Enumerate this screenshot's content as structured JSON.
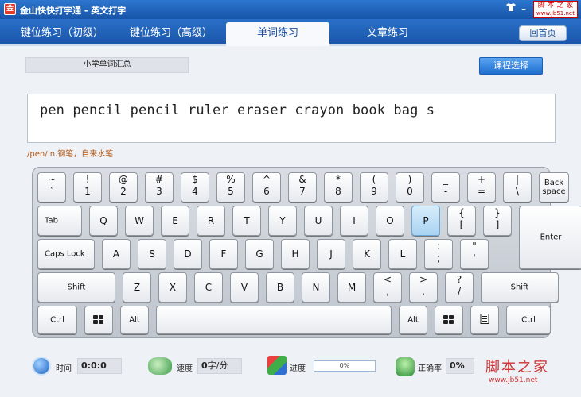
{
  "window": {
    "app_icon_text": "金",
    "title": "金山快快打字通 - 英文打字",
    "brand_top": "脚 本 之 家",
    "brand_bottom": "www.Jb51.net"
  },
  "tabs": [
    {
      "label": "键位练习（初级）",
      "active": false
    },
    {
      "label": "键位练习（高级）",
      "active": false
    },
    {
      "label": "单词练习",
      "active": true
    },
    {
      "label": "文章练习",
      "active": false
    }
  ],
  "home_button": "回首页",
  "lesson_title": "小学单词汇总",
  "course_button": "课程选择",
  "practice_text": "pen pencil pencil ruler eraser crayon book bag s",
  "phonetic": "/pen/ n.钢笔，自来水笔",
  "keyboard": {
    "highlighted_key": "P",
    "rows": [
      [
        {
          "upper": "~",
          "lower": "`"
        },
        {
          "upper": "!",
          "lower": "1"
        },
        {
          "upper": "@",
          "lower": "2"
        },
        {
          "upper": "#",
          "lower": "3"
        },
        {
          "upper": "$",
          "lower": "4"
        },
        {
          "upper": "%",
          "lower": "5"
        },
        {
          "upper": "^",
          "lower": "6"
        },
        {
          "upper": "&",
          "lower": "7"
        },
        {
          "upper": "*",
          "lower": "8"
        },
        {
          "upper": "(",
          "lower": "9"
        },
        {
          "upper": ")",
          "lower": "0"
        },
        {
          "upper": "_",
          "lower": "-"
        },
        {
          "upper": "+",
          "lower": "="
        },
        {
          "upper": "|",
          "lower": "\\"
        },
        {
          "label": "Back space"
        }
      ],
      [
        {
          "label": "Tab"
        },
        {
          "label": "Q"
        },
        {
          "label": "W"
        },
        {
          "label": "E"
        },
        {
          "label": "R"
        },
        {
          "label": "T"
        },
        {
          "label": "Y"
        },
        {
          "label": "U"
        },
        {
          "label": "I"
        },
        {
          "label": "O"
        },
        {
          "label": "P"
        },
        {
          "upper": "{",
          "lower": "["
        },
        {
          "upper": "}",
          "lower": "]"
        },
        {
          "label": "Enter"
        }
      ],
      [
        {
          "label": "Caps Lock"
        },
        {
          "label": "A"
        },
        {
          "label": "S"
        },
        {
          "label": "D"
        },
        {
          "label": "F"
        },
        {
          "label": "G"
        },
        {
          "label": "H"
        },
        {
          "label": "J"
        },
        {
          "label": "K"
        },
        {
          "label": "L"
        },
        {
          "upper": ":",
          "lower": ";"
        },
        {
          "upper": "\"",
          "lower": "'"
        }
      ],
      [
        {
          "label": "Shift"
        },
        {
          "label": "Z"
        },
        {
          "label": "X"
        },
        {
          "label": "C"
        },
        {
          "label": "V"
        },
        {
          "label": "B"
        },
        {
          "label": "N"
        },
        {
          "label": "M"
        },
        {
          "upper": "<",
          "lower": ","
        },
        {
          "upper": ">",
          "lower": "."
        },
        {
          "upper": "?",
          "lower": "/"
        },
        {
          "label": "Shift"
        }
      ],
      [
        {
          "label": "Ctrl"
        },
        {
          "icon": "windows-icon"
        },
        {
          "label": "Alt"
        },
        {
          "label": ""
        },
        {
          "label": "Alt"
        },
        {
          "icon": "windows-icon"
        },
        {
          "icon": "menu-icon"
        },
        {
          "label": "Ctrl"
        }
      ]
    ]
  },
  "status": {
    "time_label": "时间",
    "time_value": "0:0:0",
    "speed_label": "速度",
    "speed_value": "0",
    "speed_unit": "字/分",
    "progress_label": "进度",
    "progress_value": 0,
    "progress_text": "0%",
    "accuracy_label": "正确率",
    "accuracy_value": "0%"
  },
  "watermark": {
    "big": "脚本之家",
    "small": "www.jb51.net"
  },
  "colors": {
    "title_bar": "#1f64bd",
    "active_tab_text": "#1b4f9c",
    "highlight_key": "#a9d3f2",
    "phonetic": "#b35a1a",
    "watermark": "#d03030"
  }
}
